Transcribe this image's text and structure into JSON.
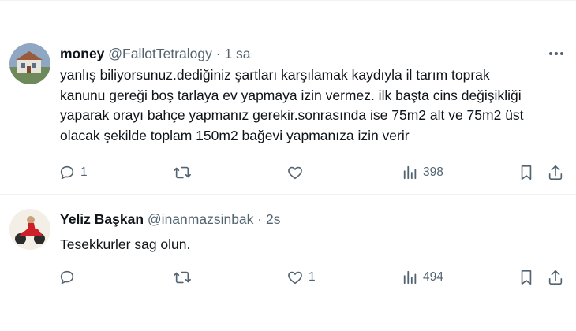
{
  "tweets": [
    {
      "display_name": "money",
      "handle": "@FallotTetralogy",
      "separator": "·",
      "time": "1 sa",
      "text_lines": [
        "yanlış biliyorsunuz.dediğiniz şartları karşılamak kaydıyla il tarım toprak",
        "kanunu gereği boş tarlaya ev yapmaya izin vermez. ilk başta cins değişikliği",
        "yaparak orayı bahçe yapmanız gerekir.sonrasında ise 75m2 alt ve 75m2 üst",
        "olacak şekilde toplam 150m2 bağevi yapmanıza izin verir"
      ],
      "replies": "1",
      "retweets": "",
      "likes": "",
      "views": "398",
      "avatar_icon": "house-photo-avatar"
    },
    {
      "display_name": "Yeliz Başkan",
      "handle": "@inanmazsinbak",
      "separator": "·",
      "time": "2s",
      "text_lines": [
        "Tesekkurler sag olun."
      ],
      "replies": "",
      "retweets": "",
      "likes": "1",
      "views": "494",
      "avatar_icon": "motorcycle-rider-avatar"
    }
  ],
  "colors": {
    "text": "#0f1419",
    "secondary": "#536471",
    "divider": "#eff3f4",
    "background": "#ffffff"
  }
}
